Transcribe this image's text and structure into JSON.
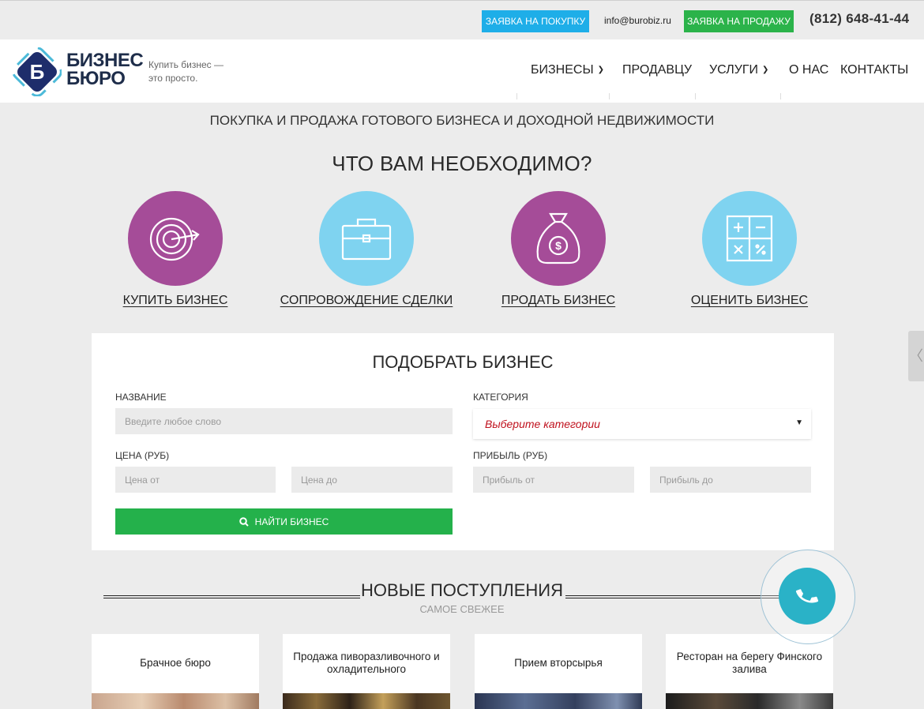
{
  "topbar": {
    "buy_request": "ЗАЯВКА НА ПОКУПКУ",
    "email": "info@burobiz.ru",
    "sell_request": "ЗАЯВКА НА ПРОДАЖУ",
    "phone": "(812) 648-41-44"
  },
  "header": {
    "logo_letter": "Б",
    "brand_line1": "БИЗНЕС",
    "brand_line2": "БЮРО",
    "tagline_line1": "Купить бизнес —",
    "tagline_line2": "это просто.",
    "nav": [
      {
        "label": "БИЗНЕСЫ",
        "has_dropdown": true
      },
      {
        "label": "ПРОДАВЦУ",
        "has_dropdown": false
      },
      {
        "label": "УСЛУГИ",
        "has_dropdown": true
      },
      {
        "label": "О НАС",
        "has_dropdown": false
      },
      {
        "label": "КОНТАКТЫ",
        "has_dropdown": false
      }
    ]
  },
  "hero": {
    "subtitle": "ПОКУПКА И ПРОДАЖА ГОТОВОГО БИЗНЕСА И ДОХОДНОЙ НЕДВИЖИМОСТИ",
    "question": "ЧТО ВАМ НЕОБХОДИМО?",
    "services": [
      {
        "label": "КУПИТЬ БИЗНЕС",
        "icon": "target-icon",
        "color": "#a54c98"
      },
      {
        "label": "СОПРОВОЖДЕНИЕ СДЕЛКИ",
        "icon": "briefcase-icon",
        "color": "#7fd3f0"
      },
      {
        "label": "ПРОДАТЬ БИЗНЕС",
        "icon": "money-bag-icon",
        "color": "#a54c98"
      },
      {
        "label": "ОЦЕНИТЬ БИЗНЕС",
        "icon": "calculator-icon",
        "color": "#7fd3f0"
      }
    ]
  },
  "filter": {
    "title": "ПОДОБРАТЬ БИЗНЕС",
    "name_label": "НАЗВАНИЕ",
    "name_placeholder": "Введите любое слово",
    "category_label": "КАТЕГОРИЯ",
    "category_value": "Выберите категории",
    "price_label": "ЦЕНА (РУБ)",
    "price_from_placeholder": "Цена от",
    "price_to_placeholder": "Цена до",
    "profit_label": "ПРИБЫЛЬ (РУБ)",
    "profit_from_placeholder": "Прибыль от",
    "profit_to_placeholder": "Прибыль до",
    "search_label": "НАЙТИ БИЗНЕС",
    "search_icon": "search-icon"
  },
  "new_arrivals": {
    "title": "НОВЫЕ ПОСТУПЛЕНИЯ",
    "subtitle": "САМОЕ СВЕЖЕЕ",
    "listings": [
      {
        "title": "Брачное бюро"
      },
      {
        "title": "Продажа пиворазливочного и охладительного"
      },
      {
        "title": "Прием вторсырья"
      },
      {
        "title": "Ресторан на берегу Финского залива"
      }
    ]
  },
  "widgets": {
    "side_tab_icon": "chevron-left-icon",
    "call_icon": "phone-icon"
  },
  "colors": {
    "buy_button": "#1eaee8",
    "sell_button": "#2bb34a",
    "search_button": "#24b14b",
    "purple": "#a54c98",
    "light_blue": "#7fd3f0",
    "select_text": "#c0121e",
    "call_button": "#2ab2c7"
  }
}
